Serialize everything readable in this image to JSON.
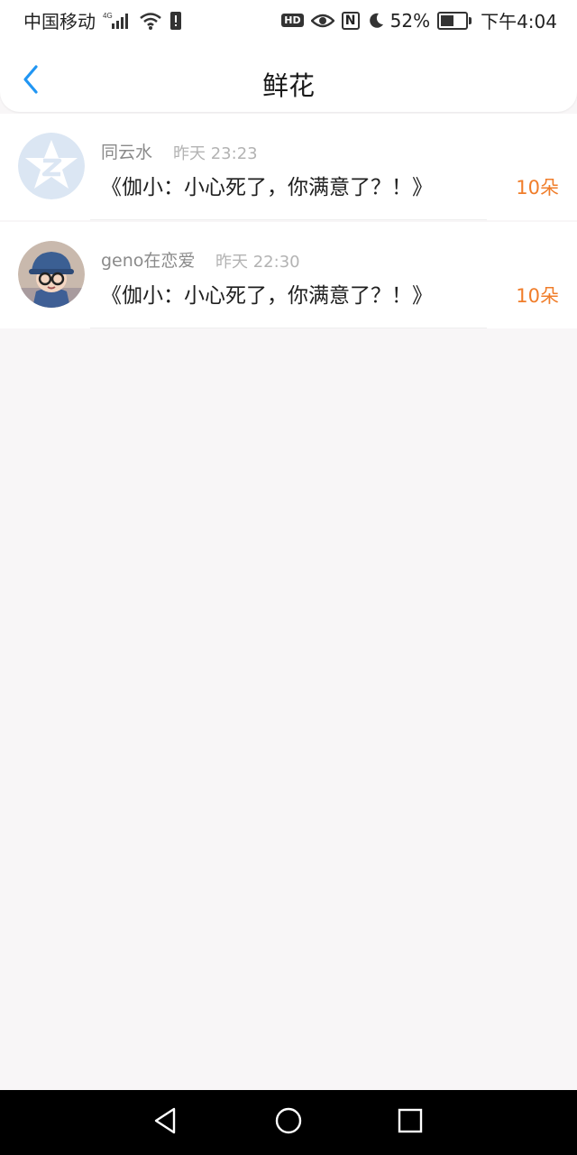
{
  "status_bar": {
    "carrier": "中国移动",
    "network": "4G",
    "battery": "52%",
    "battery_level": 0.52,
    "time": "下午4:04",
    "icons": [
      "signal-icon",
      "wifi-icon",
      "alert-icon",
      "hd-icon",
      "eye-icon",
      "nfc-icon",
      "moon-icon",
      "battery-icon"
    ]
  },
  "header": {
    "title": "鲜花",
    "back_icon": "chevron-left-icon",
    "accent": "#2196f3"
  },
  "list": {
    "items": [
      {
        "name": "同云水",
        "time": "昨天 23:23",
        "message": "《伽小：小心死了，你满意了？！》",
        "count": "10朵",
        "avatar_icon": "star-avatar-icon"
      },
      {
        "name": "geno在恋爱",
        "time": "昨天 22:30",
        "message": "《伽小：小心死了，你满意了？！》",
        "count": "10朵",
        "avatar_icon": "character-avatar-icon"
      }
    ]
  },
  "colors": {
    "count": "#f07d2a",
    "background": "#f8f6f7"
  },
  "system_nav": {
    "icons": [
      "back-triangle-icon",
      "home-circle-icon",
      "recents-square-icon"
    ]
  }
}
